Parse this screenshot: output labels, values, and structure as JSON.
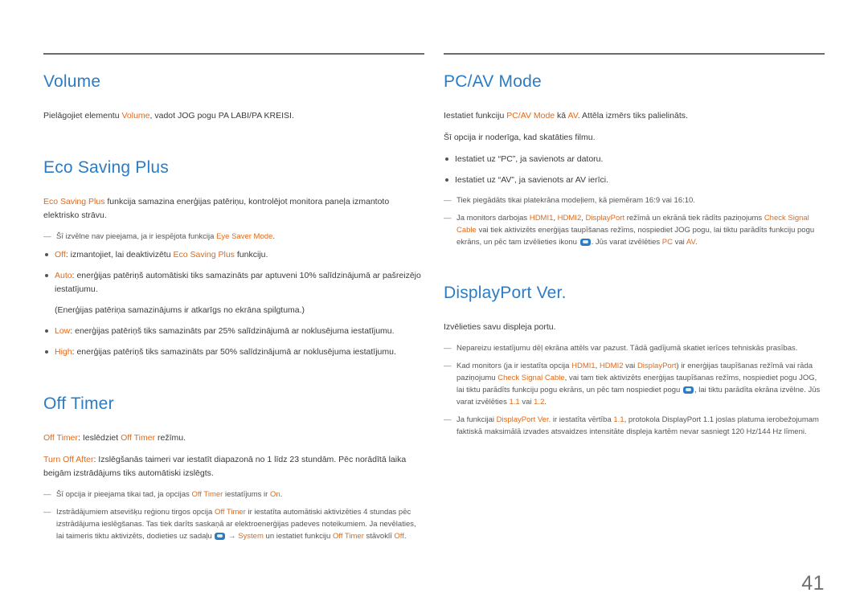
{
  "page": {
    "number": "41"
  },
  "left_column": {
    "volume": {
      "title": "Volume",
      "paragraph_1_pre": "Pielāgojiet elementu ",
      "paragraph_1_hl": "Volume",
      "paragraph_1_post": ", vadot JOG pogu PA LABI/PA KREISI."
    },
    "eco_saving_plus": {
      "title": "Eco Saving Plus",
      "paragraph_1_hl": "Eco Saving Plus",
      "paragraph_1_post": " funkcija samazina enerģijas patēriņu, kontrolējot monitora paneļa izmantoto elektrisko strāvu.",
      "note_1_pre": "Šī izvēlne nav pieejama, ja ir iespējota funkcija ",
      "note_1_hl": "Eye Saver Mode",
      "note_1_post": ".",
      "bullet_1_hl": "Off",
      "bullet_1_mid": ": izmantojiet, lai deaktivizētu ",
      "bullet_1_hl2": "Eco Saving Plus",
      "bullet_1_post": " funkciju.",
      "bullet_2_hl": "Auto",
      "bullet_2_post": ": enerģijas patēriņš automātiski tiks samazināts par aptuveni 10% salīdzinājumā ar pašreizējo iestatījumu.",
      "bullet_2_sub": "(Enerģijas patēriņa samazinājums ir atkarīgs no ekrāna spilgtuma.)",
      "bullet_3_hl": "Low",
      "bullet_3_post": ": enerģijas patēriņš tiks samazināts par 25% salīdzinājumā ar noklusējuma iestatījumu.",
      "bullet_4_hl": "High",
      "bullet_4_post": ": enerģijas patēriņš tiks samazināts par 50% salīdzinājumā ar noklusējuma iestatījumu."
    },
    "off_timer": {
      "title": "Off Timer",
      "paragraph_1_hl": "Off Timer",
      "paragraph_1_mid": ": Ieslēdziet ",
      "paragraph_1_hl2": "Off Timer",
      "paragraph_1_post": " režīmu.",
      "paragraph_2_hl": "Turn Off After",
      "paragraph_2_post": ": Izslēgšanās taimeri var iestatīt diapazonā no 1 līdz 23 stundām. Pēc norādītā laika beigām izstrādājums tiks automātiski izslēgts.",
      "note_1_pre": "Šī opcija ir pieejama tikai tad, ja opcijas ",
      "note_1_hl": "Off Timer",
      "note_1_mid": " iestatījums ir ",
      "note_1_hl2": "On",
      "note_1_post": ".",
      "note_2_pre": "Izstrādājumiem atsevišķu reģionu tirgos opcija ",
      "note_2_hl": "Off Timer",
      "note_2_post": " ir iestatīta automātiski aktivizēties 4 stundas pēc izstrādājuma ieslēgšanas. Tas tiek darīts saskaņā ar elektroenerģijas padeves noteikumiem. Ja nevēlaties, lai taimeris tiktu aktivizēts, dodieties uz sadaļu ",
      "note_2_arrow_1": " → ",
      "note_2_hl2": "System",
      "note_2_mid2": " un iestatiet funkciju ",
      "note_2_hl3": "Off Timer",
      "note_2_mid3": " stāvoklī ",
      "note_2_hl4": "Off",
      "note_2_end": "."
    }
  },
  "right_column": {
    "pc_av_mode": {
      "title": "PC/AV Mode",
      "paragraph_1_pre": "Iestatiet funkciju ",
      "paragraph_1_hl": "PC/AV Mode",
      "paragraph_1_mid": " kā ",
      "paragraph_1_hl2": "AV",
      "paragraph_1_post": ". Attēla izmērs tiks palielināts.",
      "paragraph_2": "Šī opcija ir noderīga, kad skatāties filmu.",
      "bullet_1": "Iestatiet uz “PC”, ja savienots ar datoru.",
      "bullet_2": "Iestatiet uz “AV”, ja savienots ar AV ierīci.",
      "note_1": "Tiek piegādāts tikai platekrāna modeļiem, kā piemēram 16:9 vai 16:10.",
      "note_2_pre": "Ja monitors darbojas ",
      "note_2_hl1": "HDMI1",
      "note_2_sep1": ", ",
      "note_2_hl2": "HDMI2",
      "note_2_sep2": ", ",
      "note_2_hl3": "DisplayPort",
      "note_2_mid": " režīmā un ekrānā tiek rādīts paziņojums ",
      "note_2_hl4": "Check Signal Cable",
      "note_2_post": " vai tiek aktivizēts enerģijas taupīšanas režīms, nospiediet JOG pogu, lai tiktu parādīts funkciju pogu ekrāns, un pēc tam izvēlieties ikonu ",
      "note_2_tail_pre": ". Jūs varat izvēlēties ",
      "note_2_hl5": "PC",
      "note_2_tail_mid": " vai ",
      "note_2_hl6": "AV",
      "note_2_tail_end": "."
    },
    "displayport_ver": {
      "title": "DisplayPort Ver.",
      "paragraph_1": "Izvēlieties savu displeja portu.",
      "note_1": "Nepareizu iestatījumu dēļ ekrāna attēls var pazust. Tādā gadījumā skatiet ierīces tehniskās prasības.",
      "note_2_pre": "Kad monitors (ja ir iestatīta opcija ",
      "note_2_hl1": "HDMI1",
      "note_2_sep1": ", ",
      "note_2_hl2": "HDMI2",
      "note_2_mid1": " vai ",
      "note_2_hl3": "DisplayPort",
      "note_2_mid2": ") ir enerģijas taupīšanas režīmā vai rāda paziņojumu ",
      "note_2_hl4": "Check Signal Cable",
      "note_2_post": ", vai tam tiek aktivizēts enerģijas taupīšanas režīms, nospiediet pogu JOG, lai tiktu parādīts funkciju pogu ekrāns, un pēc tam nospiediet pogu ",
      "note_2_tail_pre": ", lai tiktu parādīta ekrāna izvēlne. Jūs varat izvēlēties ",
      "note_2_hl5": "1.1",
      "note_2_tail_mid": " vai ",
      "note_2_hl6": "1.2",
      "note_2_tail_end": ".",
      "note_3_pre": "Ja funkcijai ",
      "note_3_hl1": "DisplayPort Ver.",
      "note_3_mid": " ir iestatīta vērtība ",
      "note_3_hl2": "1.1",
      "note_3_post": ", protokola DisplayPort 1.1 joslas platuma ierobežojumam faktiskā maksimālā izvades atsvaidzes intensitāte displeja kartēm nevar sasniegt 120 Hz/144 Hz līmeni."
    }
  }
}
